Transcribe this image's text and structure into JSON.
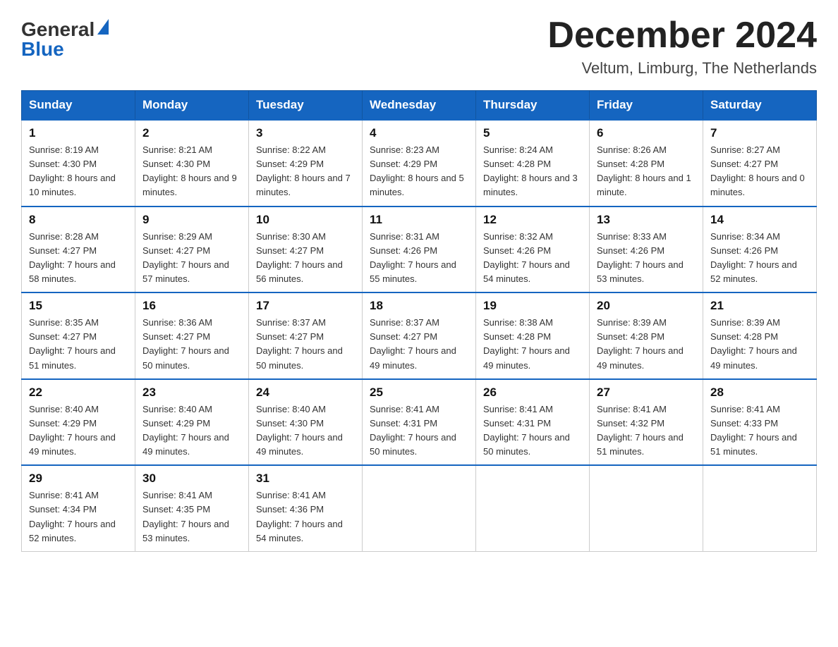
{
  "header": {
    "logo_general": "General",
    "logo_blue": "Blue",
    "title": "December 2024",
    "subtitle": "Veltum, Limburg, The Netherlands"
  },
  "weekdays": [
    "Sunday",
    "Monday",
    "Tuesday",
    "Wednesday",
    "Thursday",
    "Friday",
    "Saturday"
  ],
  "weeks": [
    [
      {
        "day": "1",
        "sunrise": "8:19 AM",
        "sunset": "4:30 PM",
        "daylight": "8 hours and 10 minutes."
      },
      {
        "day": "2",
        "sunrise": "8:21 AM",
        "sunset": "4:30 PM",
        "daylight": "8 hours and 9 minutes."
      },
      {
        "day": "3",
        "sunrise": "8:22 AM",
        "sunset": "4:29 PM",
        "daylight": "8 hours and 7 minutes."
      },
      {
        "day": "4",
        "sunrise": "8:23 AM",
        "sunset": "4:29 PM",
        "daylight": "8 hours and 5 minutes."
      },
      {
        "day": "5",
        "sunrise": "8:24 AM",
        "sunset": "4:28 PM",
        "daylight": "8 hours and 3 minutes."
      },
      {
        "day": "6",
        "sunrise": "8:26 AM",
        "sunset": "4:28 PM",
        "daylight": "8 hours and 1 minute."
      },
      {
        "day": "7",
        "sunrise": "8:27 AM",
        "sunset": "4:27 PM",
        "daylight": "8 hours and 0 minutes."
      }
    ],
    [
      {
        "day": "8",
        "sunrise": "8:28 AM",
        "sunset": "4:27 PM",
        "daylight": "7 hours and 58 minutes."
      },
      {
        "day": "9",
        "sunrise": "8:29 AM",
        "sunset": "4:27 PM",
        "daylight": "7 hours and 57 minutes."
      },
      {
        "day": "10",
        "sunrise": "8:30 AM",
        "sunset": "4:27 PM",
        "daylight": "7 hours and 56 minutes."
      },
      {
        "day": "11",
        "sunrise": "8:31 AM",
        "sunset": "4:26 PM",
        "daylight": "7 hours and 55 minutes."
      },
      {
        "day": "12",
        "sunrise": "8:32 AM",
        "sunset": "4:26 PM",
        "daylight": "7 hours and 54 minutes."
      },
      {
        "day": "13",
        "sunrise": "8:33 AM",
        "sunset": "4:26 PM",
        "daylight": "7 hours and 53 minutes."
      },
      {
        "day": "14",
        "sunrise": "8:34 AM",
        "sunset": "4:26 PM",
        "daylight": "7 hours and 52 minutes."
      }
    ],
    [
      {
        "day": "15",
        "sunrise": "8:35 AM",
        "sunset": "4:27 PM",
        "daylight": "7 hours and 51 minutes."
      },
      {
        "day": "16",
        "sunrise": "8:36 AM",
        "sunset": "4:27 PM",
        "daylight": "7 hours and 50 minutes."
      },
      {
        "day": "17",
        "sunrise": "8:37 AM",
        "sunset": "4:27 PM",
        "daylight": "7 hours and 50 minutes."
      },
      {
        "day": "18",
        "sunrise": "8:37 AM",
        "sunset": "4:27 PM",
        "daylight": "7 hours and 49 minutes."
      },
      {
        "day": "19",
        "sunrise": "8:38 AM",
        "sunset": "4:28 PM",
        "daylight": "7 hours and 49 minutes."
      },
      {
        "day": "20",
        "sunrise": "8:39 AM",
        "sunset": "4:28 PM",
        "daylight": "7 hours and 49 minutes."
      },
      {
        "day": "21",
        "sunrise": "8:39 AM",
        "sunset": "4:28 PM",
        "daylight": "7 hours and 49 minutes."
      }
    ],
    [
      {
        "day": "22",
        "sunrise": "8:40 AM",
        "sunset": "4:29 PM",
        "daylight": "7 hours and 49 minutes."
      },
      {
        "day": "23",
        "sunrise": "8:40 AM",
        "sunset": "4:29 PM",
        "daylight": "7 hours and 49 minutes."
      },
      {
        "day": "24",
        "sunrise": "8:40 AM",
        "sunset": "4:30 PM",
        "daylight": "7 hours and 49 minutes."
      },
      {
        "day": "25",
        "sunrise": "8:41 AM",
        "sunset": "4:31 PM",
        "daylight": "7 hours and 50 minutes."
      },
      {
        "day": "26",
        "sunrise": "8:41 AM",
        "sunset": "4:31 PM",
        "daylight": "7 hours and 50 minutes."
      },
      {
        "day": "27",
        "sunrise": "8:41 AM",
        "sunset": "4:32 PM",
        "daylight": "7 hours and 51 minutes."
      },
      {
        "day": "28",
        "sunrise": "8:41 AM",
        "sunset": "4:33 PM",
        "daylight": "7 hours and 51 minutes."
      }
    ],
    [
      {
        "day": "29",
        "sunrise": "8:41 AM",
        "sunset": "4:34 PM",
        "daylight": "7 hours and 52 minutes."
      },
      {
        "day": "30",
        "sunrise": "8:41 AM",
        "sunset": "4:35 PM",
        "daylight": "7 hours and 53 minutes."
      },
      {
        "day": "31",
        "sunrise": "8:41 AM",
        "sunset": "4:36 PM",
        "daylight": "7 hours and 54 minutes."
      },
      null,
      null,
      null,
      null
    ]
  ]
}
